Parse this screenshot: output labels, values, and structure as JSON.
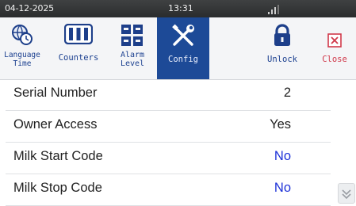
{
  "status": {
    "date": "04-12-2025",
    "time": "13:31"
  },
  "toolbar": {
    "items": [
      {
        "label": "Language\nTime",
        "icon": "globe-clock-icon"
      },
      {
        "label": "Counters",
        "icon": "counters-icon"
      },
      {
        "label": "Alarm\nLevel",
        "icon": "alarm-grid-icon"
      },
      {
        "label": "Config",
        "icon": "wrench-screwdriver-icon",
        "active": true
      },
      {
        "label": "Unlock",
        "icon": "lock-icon"
      },
      {
        "label": "Close",
        "icon": "close-icon"
      }
    ]
  },
  "rows": [
    {
      "label": "Serial Number",
      "value": "2"
    },
    {
      "label": "Owner Access",
      "value": "Yes"
    },
    {
      "label": "Milk Start Code",
      "value": "No"
    },
    {
      "label": "Milk Stop Code",
      "value": "No"
    }
  ],
  "colors": {
    "accent": "#1d4a97",
    "value_blue": "#1e32d8",
    "close_red": "#d0384a"
  }
}
